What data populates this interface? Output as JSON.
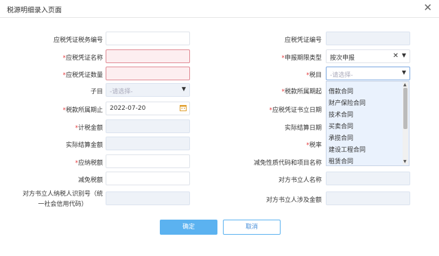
{
  "dialog": {
    "title": "税源明细录入页面",
    "close_label": "✕"
  },
  "labels": {
    "tax_voucher_no": "应税凭证税务编号",
    "voucher_no": "应税凭证编号",
    "voucher_name": "应税凭证名称",
    "period_type": "申报期限类型",
    "voucher_qty": "应税凭证数量",
    "tax_item": "税目",
    "sub_item": "子目",
    "period_start": "税款所属期起",
    "period_end": "税款所属期止",
    "voucher_date": "应税凭证书立日期",
    "tax_amount": "计税金额",
    "settle_date": "实际结算日期",
    "settle_amount": "实际结算金额",
    "tax_rate": "税率",
    "payable": "应纳税额",
    "exempt_code": "减免性质代码和项目名称",
    "exempt_amount": "减免税额",
    "counterparty_name": "对方书立人名称",
    "counterparty_id_1": "对方书立人纳税人识别号（统",
    "counterparty_id_2": "一社会信用代码）",
    "counterparty_amount": "对方书立人涉及金额"
  },
  "values": {
    "period_type": "按次申报",
    "period_end": "2022-07-20"
  },
  "placeholders": {
    "tax_item": "-请选择-",
    "sub_item": "-请选择-"
  },
  "tax_item_options": [
    "借款合同",
    "财产保险合同",
    "技术合同",
    "买卖合同",
    "承揽合同",
    "建设工程合同",
    "租赁合同"
  ],
  "buttons": {
    "ok": "确定",
    "cancel": "取消"
  },
  "colors": {
    "required": "#e4393c",
    "primary": "#5bb2f0",
    "error_bg": "#fdeef0",
    "disabled_bg": "#eef2f8"
  }
}
